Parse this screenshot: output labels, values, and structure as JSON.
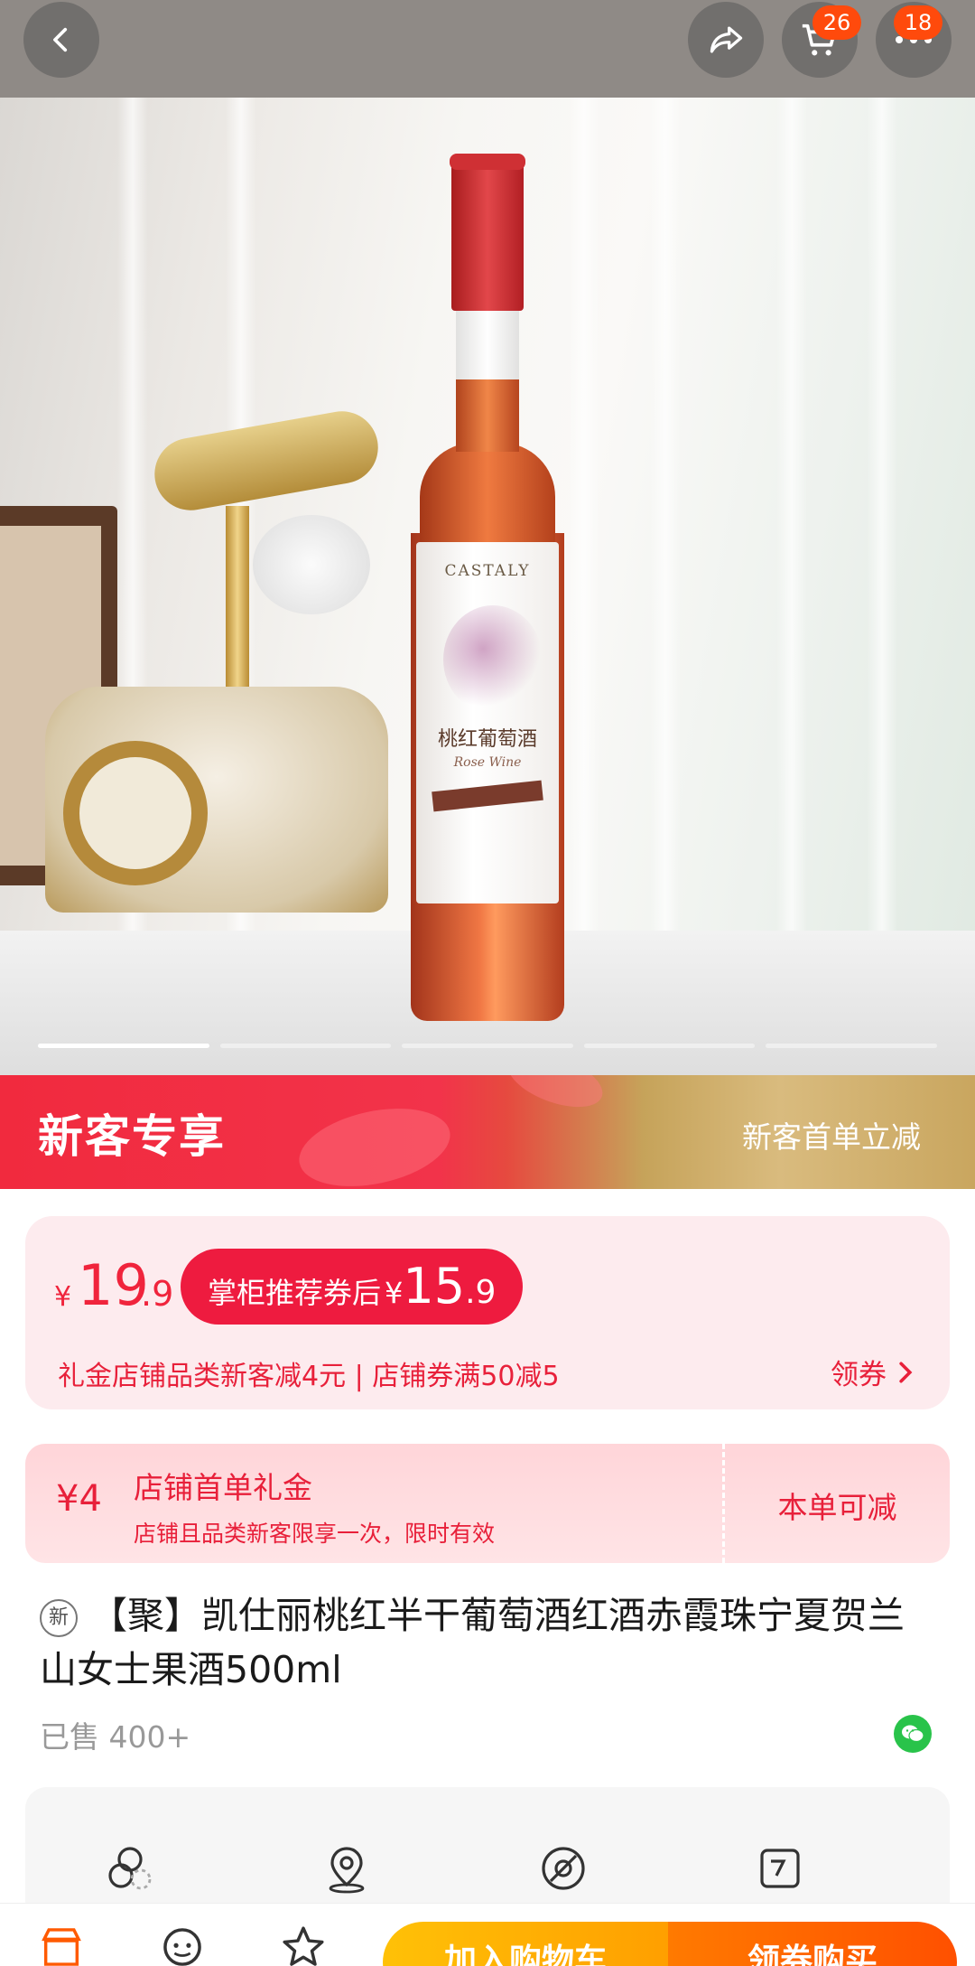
{
  "header": {
    "back_icon": "chevron-left-icon",
    "share_icon": "share-icon",
    "cart_icon": "cart-icon",
    "cart_badge": "26",
    "more_icon": "more-icon",
    "more_badge": "18"
  },
  "gallery": {
    "pages": 5,
    "active_page": 1,
    "bottle_brand": "CASTALY",
    "bottle_name": "桃红葡萄酒",
    "bottle_sub": "Rose Wine"
  },
  "promo_banner": {
    "title": "新客专享",
    "right_text": "新客首单立减"
  },
  "price": {
    "currency": "¥",
    "integer": "19",
    "decimal": ".9",
    "coupon_text": "掌柜推荐券后",
    "coupon_currency": "¥",
    "coupon_integer": "15",
    "coupon_decimal": ".9",
    "note": "礼金店铺品类新客减4元 | 店铺券满50减5",
    "link_label": "领券",
    "link_icon": "chevron-right-icon"
  },
  "gift": {
    "amount": "¥4",
    "title": "店铺首单礼金",
    "desc": "店铺且品类新客限享一次，限时有效",
    "action": "本单可减"
  },
  "product": {
    "tag": "新",
    "title": "【聚】凯仕丽桃红半干葡萄酒红酒赤霞珠宁夏贺兰山女士果酒500ml",
    "sold": "已售 400+",
    "share_icon": "wechat-icon"
  },
  "features": [
    {
      "icon": "circles-icon"
    },
    {
      "icon": "location-icon"
    },
    {
      "icon": "disc-icon"
    },
    {
      "icon": "ticket-icon"
    }
  ],
  "bottom_bar": {
    "store_icon": "store-icon",
    "service_icon": "service-icon",
    "favorite_icon": "star-icon",
    "add_to_cart": "加入购物车",
    "buy_with_coupon": "领券购买"
  },
  "colors": {
    "accent_red": "#f0243c",
    "banner_red": "#f12a3e",
    "cart_yellow": "#ffb300",
    "buy_orange": "#ff5a00",
    "badge_orange": "#ff4a0c"
  }
}
